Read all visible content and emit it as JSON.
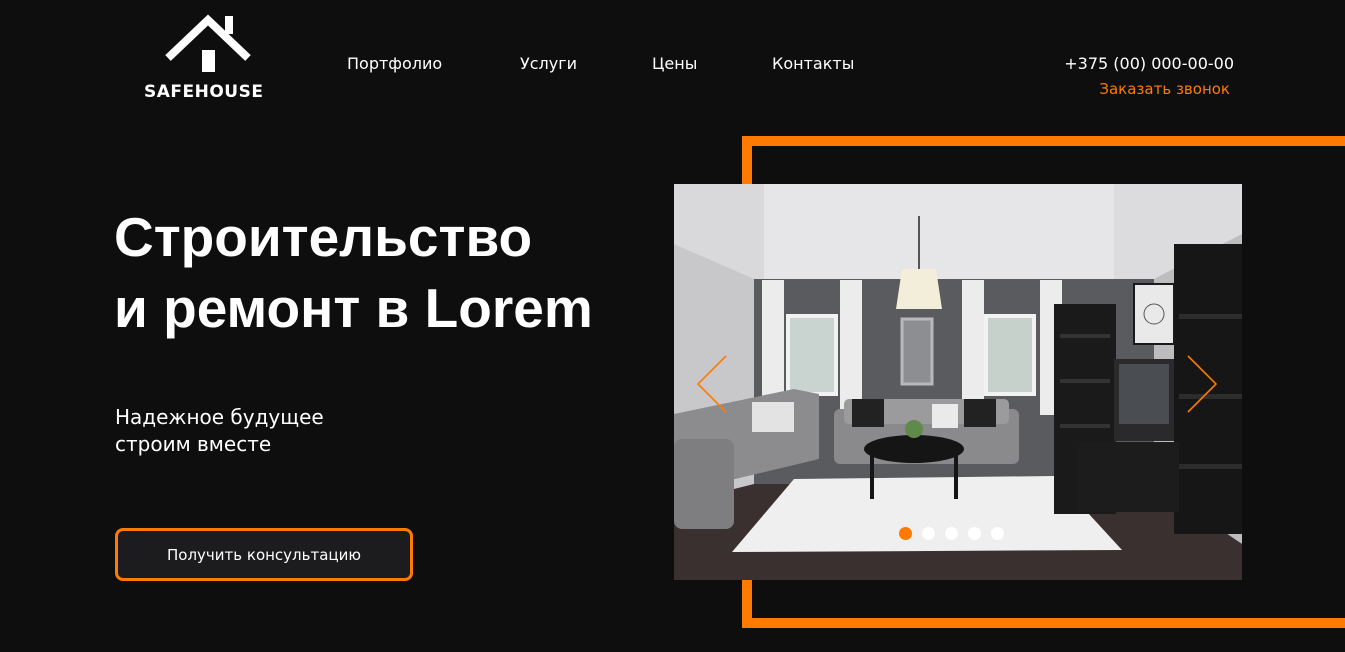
{
  "brand": {
    "name": "SAFEHOUSE",
    "logo_icon": "house-roof-icon"
  },
  "nav": {
    "items": [
      {
        "label": "Портфолио"
      },
      {
        "label": "Услуги"
      },
      {
        "label": "Цены"
      },
      {
        "label": "Контакты"
      }
    ]
  },
  "contact": {
    "phone": "+375 (00) 000-00-00",
    "callback_label": "Заказать звонок"
  },
  "hero": {
    "title_line1": "Строительство",
    "title_line2": "и ремонт в Lorem",
    "subtitle_line1": "Надежное будущее",
    "subtitle_line2": "строим вместе",
    "cta_label": "Получить консультацию"
  },
  "slider": {
    "image": "living-room-interior-photo",
    "prev_icon": "chevron-left-icon",
    "next_icon": "chevron-right-icon",
    "slide_count": 5,
    "active_slide": 1
  },
  "colors": {
    "background": "#0e0e0f",
    "accent": "#ff7a00",
    "text": "#ffffff",
    "button_bg": "#1c1c1e"
  }
}
